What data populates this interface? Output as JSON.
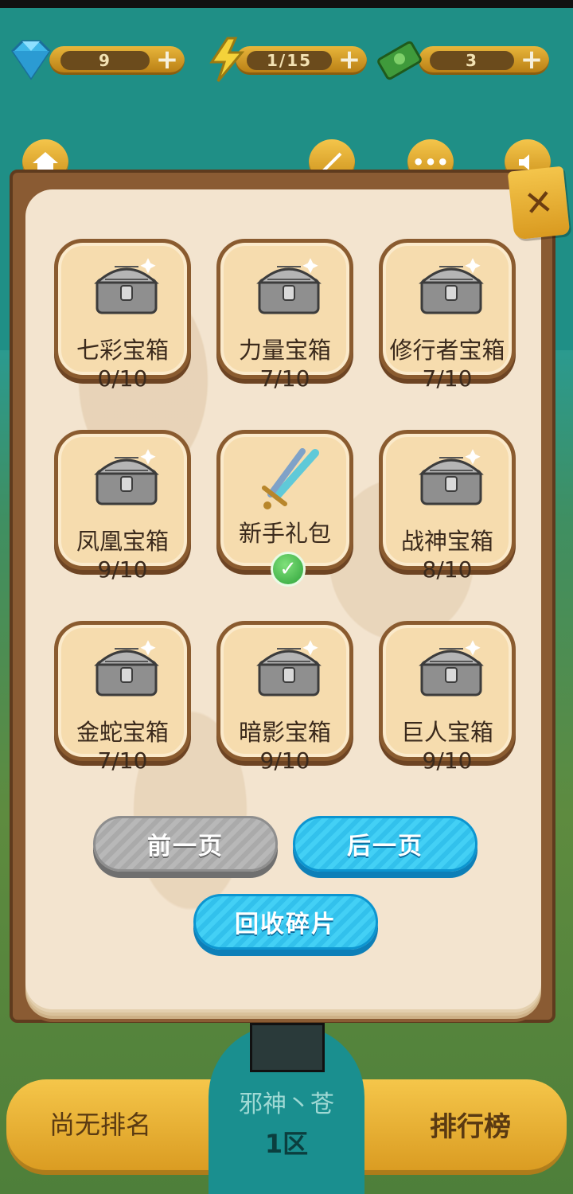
{
  "hud": {
    "gems": "9",
    "energy": "1/15",
    "cash": "3",
    "plus": "+"
  },
  "top_buttons": {
    "more": "•••"
  },
  "panel": {
    "close_glyph": "✕",
    "tiles": [
      {
        "name": "七彩宝箱",
        "count": "0/10"
      },
      {
        "name": "力量宝箱",
        "count": "7/10"
      },
      {
        "name": "修行者宝箱",
        "count": "7/10"
      },
      {
        "name": "凤凰宝箱",
        "count": "9/10"
      },
      {
        "name": "新手礼包",
        "count": ""
      },
      {
        "name": "战神宝箱",
        "count": "8/10"
      },
      {
        "name": "金蛇宝箱",
        "count": "7/10"
      },
      {
        "name": "暗影宝箱",
        "count": "9/10"
      },
      {
        "name": "巨人宝箱",
        "count": "9/10"
      }
    ],
    "prev_label": "前一页",
    "next_label": "后一页",
    "recycle_label": "回收碎片"
  },
  "footer": {
    "no_rank": "尚无排名",
    "player": "邪神丶苍",
    "server": "1区",
    "leaderboard": "排行榜"
  },
  "colors": {
    "accent_blue": "#32c1ec",
    "gold": "#e8b63b",
    "parchment": "#f3e4cf"
  }
}
